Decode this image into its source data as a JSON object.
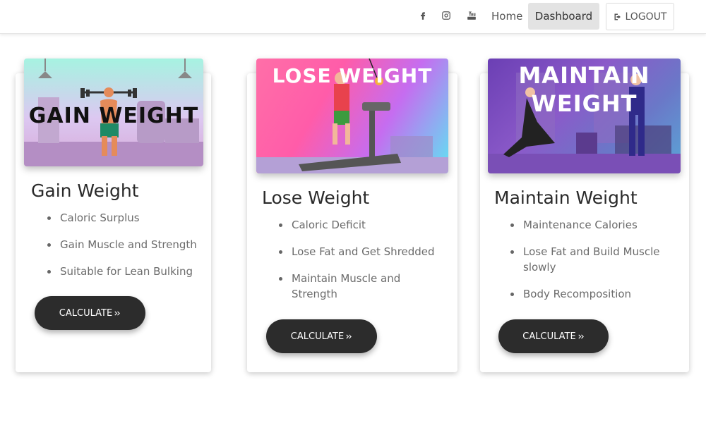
{
  "nav": {
    "social": [
      {
        "name": "facebook-icon"
      },
      {
        "name": "instagram-icon"
      },
      {
        "name": "youtube-icon"
      }
    ],
    "home_label": "Home",
    "dashboard_label": "Dashboard",
    "logout_label": "LOGOUT"
  },
  "cards": [
    {
      "banner_text": "GAIN WEIGHT",
      "title": "Gain Weight",
      "features": [
        "Caloric Surplus",
        "Gain Muscle and Strength",
        "Suitable for Lean Bulking"
      ],
      "button_label": "CALCULATE"
    },
    {
      "banner_text": "LOSE WEIGHT",
      "title": "Lose Weight",
      "features": [
        "Caloric Deficit",
        "Lose Fat and Get Shredded",
        "Maintain Muscle and Strength"
      ],
      "button_label": "CALCULATE"
    },
    {
      "banner_text": "MAINTAIN WEIGHT",
      "title": "Maintain Weight",
      "features": [
        "Maintenance Calories",
        "Lose Fat and Build Muscle slowly",
        "Body Recomposition"
      ],
      "button_label": "CALCULATE"
    }
  ],
  "colors": {
    "button_bg": "#2c2c2c",
    "dashboard_active_bg": "#e3e3e3"
  }
}
